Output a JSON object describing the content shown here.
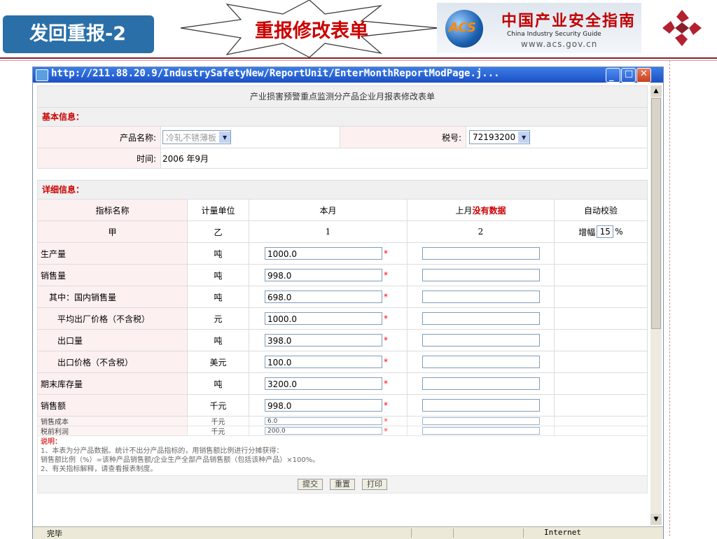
{
  "slide": {
    "tag": "发回重报-2",
    "headline": "重报修改表单",
    "acs_logo_text": "ACS",
    "acs_cn": "中国产业安全指南",
    "acs_en": "China Industry Security Guide",
    "acs_url": "www.acs.gov.cn"
  },
  "browser": {
    "title": "http://211.88.20.9/IndustrySafetyNew/ReportUnit/EnterMonthReportModPage.j...",
    "status_left": "完毕",
    "status_right": "Internet"
  },
  "form": {
    "title": "产业损害预警重点监测分产品企业月报表修改表单",
    "basic_label": "基本信息：",
    "product_label": "产品名称:",
    "product_value": "冷轧不锈薄板",
    "tax_label": "税号:",
    "tax_value": "72193200",
    "time_label": "时间:",
    "time_value": "2006 年9月",
    "detail_label": "详细信息：",
    "headers": {
      "name": "指标名称",
      "unit": "计量单位",
      "current": "本月",
      "last_prefix": "上月",
      "last_note": "没有数据",
      "check": "自动校验"
    },
    "code_row": {
      "name": "甲",
      "unit": "乙",
      "current": "1",
      "last": "2",
      "growth_label": "增幅",
      "growth_value": "15",
      "growth_unit": "%"
    },
    "rows": [
      {
        "name": "生产量",
        "unit": "吨",
        "value": "1000.0"
      },
      {
        "name": "销售量",
        "unit": "吨",
        "value": "998.0"
      },
      {
        "name": "其中：国内销售量",
        "unit": "吨",
        "value": "698.0"
      },
      {
        "name": "平均出厂价格（不含税）",
        "unit": "元",
        "value": "1000.0"
      },
      {
        "name": "出口量",
        "unit": "吨",
        "value": "398.0"
      },
      {
        "name": "出口价格（不含税）",
        "unit": "美元",
        "value": "100.0"
      },
      {
        "name": "期末库存量",
        "unit": "吨",
        "value": "3200.0"
      },
      {
        "name": "销售额",
        "unit": "千元",
        "value": "998.0"
      },
      {
        "name": "销售成本",
        "unit": "千元",
        "value": "6.0"
      },
      {
        "name": "税前利润",
        "unit": "千元",
        "value": "200.0"
      }
    ],
    "required_mark": "*",
    "notes_label": "说明：",
    "note1": "1、本表为分产品数据。统计不出分产品指标的，用销售额比例进行分摊获得：",
    "note1b": "销售额比例（%）=该种产品销售额/企业生产全部产品销售额（包括该种产品）×100%。",
    "note2": "2、有关指标解释，请查看报表制度。",
    "btn_submit": "提交",
    "btn_reset": "重置",
    "btn_print": "打印"
  }
}
